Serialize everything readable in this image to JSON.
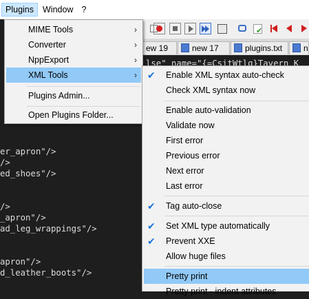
{
  "menubar": {
    "plugins": "Plugins",
    "window": "Window",
    "help": "?"
  },
  "tabs": [
    {
      "label": "ew 19"
    },
    {
      "label": "new 17"
    },
    {
      "label": "plugins.txt"
    },
    {
      "label": "ne"
    }
  ],
  "editor": {
    "top_line": "lse\" name=\"{=CsitWtlg}Tavern K",
    "lines": [
      "er_apron\"/>",
      "/>",
      "ed_shoes\"/>",
      "/>",
      "_apron\"/>",
      "ad_leg_wrappings\"/>",
      "apron\"/>",
      "d_leather_boots\"/>"
    ]
  },
  "plugins_menu": {
    "items": [
      {
        "label": "MIME Tools",
        "submenu": true
      },
      {
        "label": "Converter",
        "submenu": true
      },
      {
        "label": "NppExport",
        "submenu": true
      },
      {
        "label": "XML Tools",
        "submenu": true
      },
      {
        "label": "Plugins Admin..."
      },
      {
        "label": "Open Plugins Folder..."
      }
    ],
    "arrow": "›"
  },
  "xml_menu": {
    "items": [
      {
        "label": "Enable XML syntax auto-check",
        "checked": true
      },
      {
        "label": "Check XML syntax now"
      },
      {
        "label": "Enable auto-validation"
      },
      {
        "label": "Validate now"
      },
      {
        "label": "First error"
      },
      {
        "label": "Previous error"
      },
      {
        "label": "Next error"
      },
      {
        "label": "Last error"
      },
      {
        "label": "Tag auto-close",
        "checked": true
      },
      {
        "label": "Set XML type automatically",
        "checked": true
      },
      {
        "label": "Prevent XXE",
        "checked": true
      },
      {
        "label": "Allow huge files"
      },
      {
        "label": "Pretty print"
      },
      {
        "label": "Pretty print - indent attributes"
      }
    ],
    "check": "✔"
  },
  "colors": {
    "highlight": "#91c9f7",
    "editor_bg": "#1e1e1e",
    "menu_bg": "#f2f2f2",
    "check": "#1a73d6"
  }
}
